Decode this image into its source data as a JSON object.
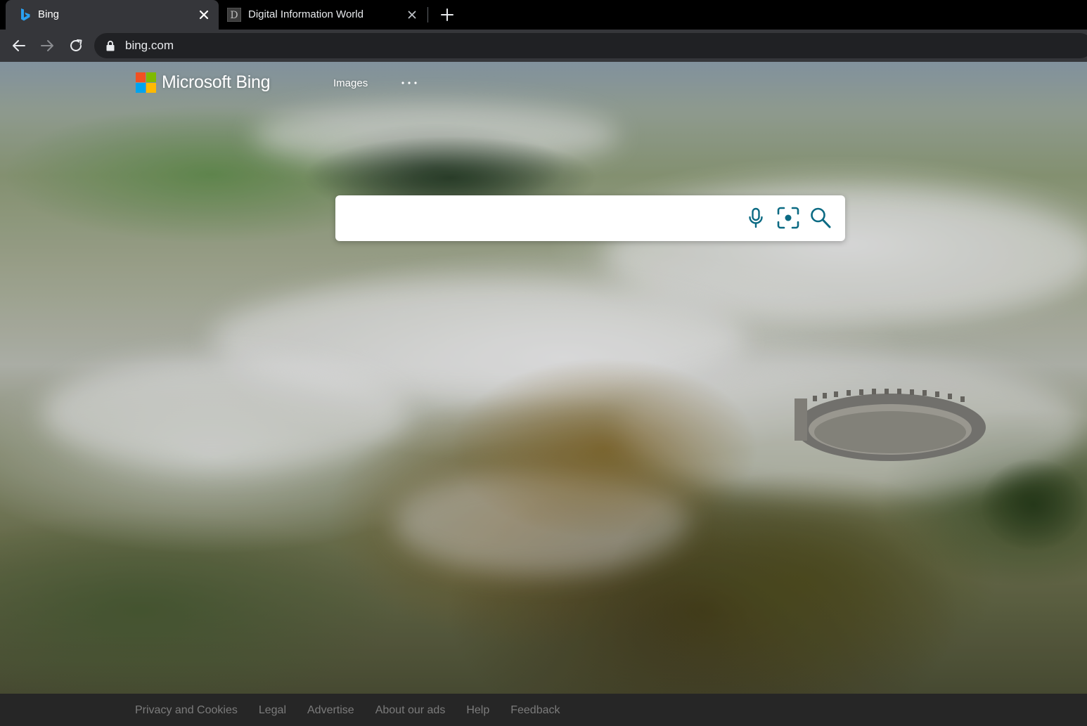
{
  "browser": {
    "tabs": [
      {
        "title": "Bing",
        "favicon": "bing-icon",
        "active": true
      },
      {
        "title": "Digital Information World",
        "favicon": "d-letter-icon",
        "favicon_letter": "D",
        "active": false
      }
    ],
    "address_bar": {
      "url": "bing.com",
      "secure": true
    }
  },
  "header": {
    "logo_text": "Microsoft Bing",
    "nav": {
      "images": "Images",
      "more": "..."
    }
  },
  "search": {
    "placeholder": "",
    "value": "",
    "icons": [
      "microphone-icon",
      "visual-search-icon",
      "search-icon"
    ],
    "accent_color": "#0b6a83"
  },
  "footer": {
    "links": [
      "Privacy and Cookies",
      "Legal",
      "Advertise",
      "About our ads",
      "Help",
      "Feedback"
    ]
  },
  "colors": {
    "ms_red": "#f25022",
    "ms_green": "#7fba00",
    "ms_blue": "#00a4ef",
    "ms_yellow": "#ffb900",
    "bing_blue": "#1e90ff"
  }
}
